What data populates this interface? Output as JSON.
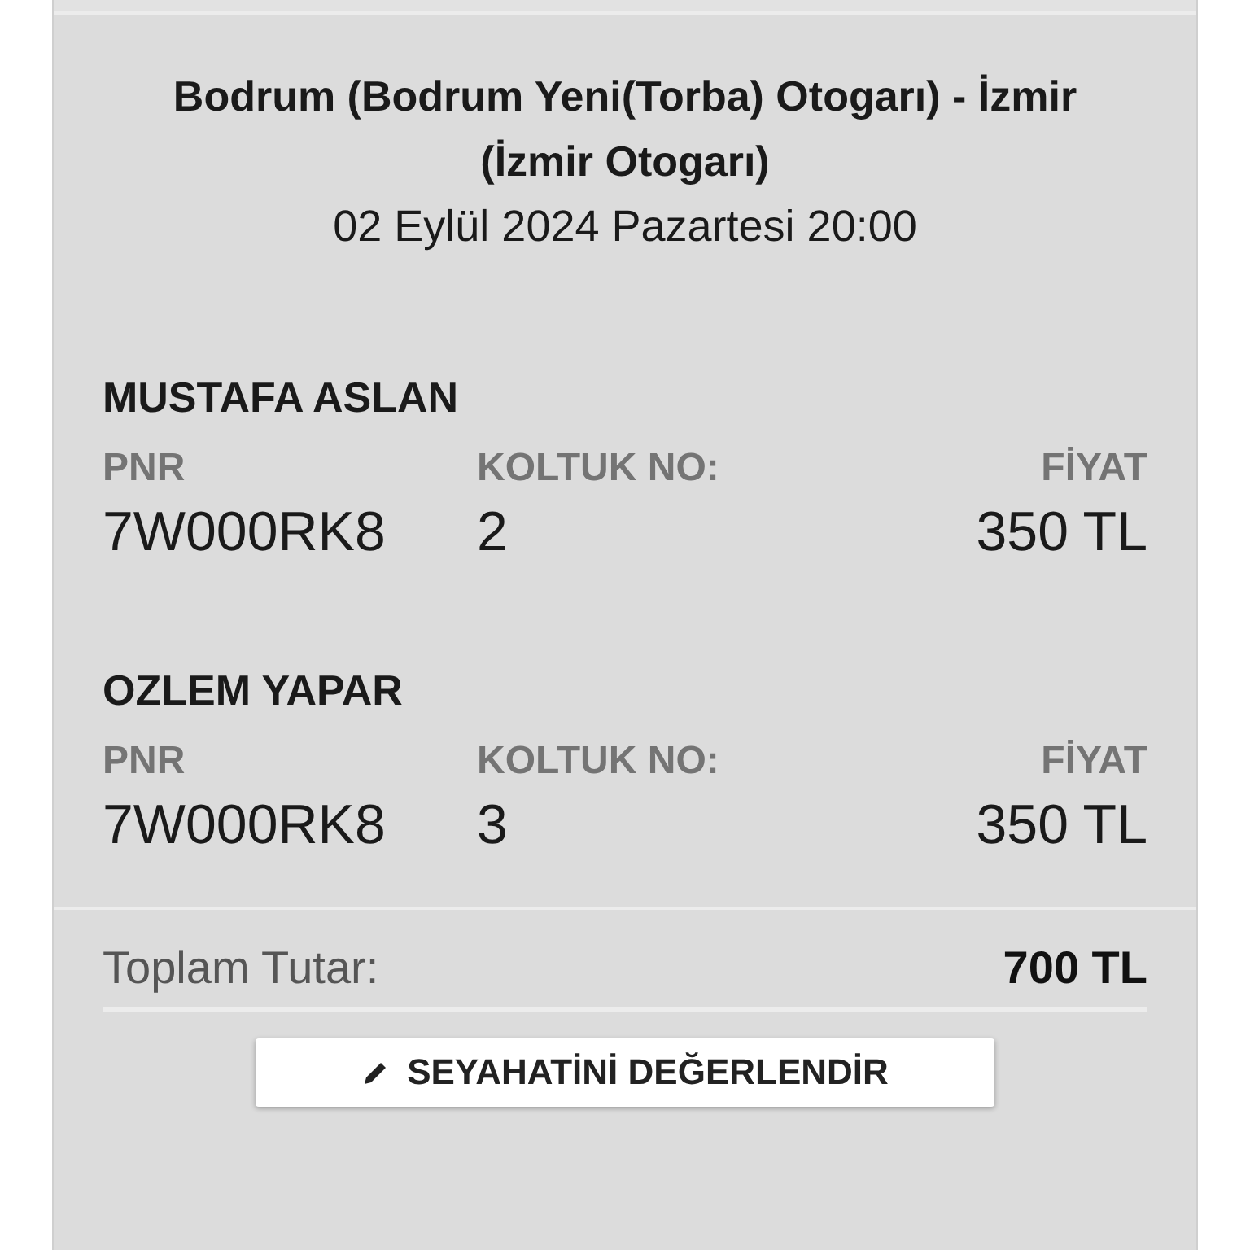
{
  "trip": {
    "route": "Bodrum (Bodrum Yeni(Torba) Otogarı) - İzmir (İzmir Otogarı)",
    "datetime": "02 Eylül 2024 Pazartesi 20:00"
  },
  "passengers": [
    {
      "name": "MUSTAFA ASLAN",
      "pnr_label": "PNR",
      "pnr": "7W000RK8",
      "seat_label": "KOLTUK NO:",
      "seat": "2",
      "price_label": "FİYAT",
      "price": "350 TL"
    },
    {
      "name": "OZLEM YAPAR",
      "pnr_label": "PNR",
      "pnr": "7W000RK8",
      "seat_label": "KOLTUK NO:",
      "seat": "3",
      "price_label": "FİYAT",
      "price": "350 TL"
    }
  ],
  "total": {
    "label": "Toplam Tutar:",
    "value": "700 TL"
  },
  "rate_button": {
    "label": "SEYAHATİNİ DEĞERLENDİR"
  }
}
